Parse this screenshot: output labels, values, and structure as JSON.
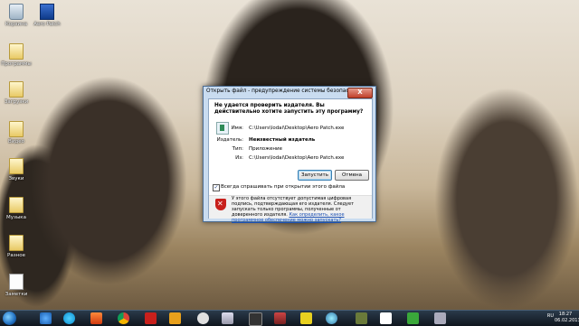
{
  "desktop": {
    "icons": [
      {
        "label": "Корзина",
        "icon": "recycle-bin-icon"
      },
      {
        "label": "Aero Patch",
        "icon": "aero-patch-icon"
      },
      {
        "label": "Программы",
        "icon": "folder-icon"
      },
      {
        "label": "Загрузки",
        "icon": "folder-icon"
      },
      {
        "label": "Видео",
        "icon": "folder-icon"
      },
      {
        "label": "Звуки",
        "icon": "folder-icon"
      },
      {
        "label": "Музыка",
        "icon": "folder-icon"
      },
      {
        "label": "Разное",
        "icon": "folder-icon"
      },
      {
        "label": "Заметки",
        "icon": "file-icon"
      }
    ]
  },
  "dialog": {
    "title": "Открыть файл - предупреждение системы безопасности",
    "close_label": "X",
    "question": "Не удается проверить издателя.  Вы действительно хотите запустить эту программу?",
    "fields": [
      {
        "label": "Имя:",
        "value": "C:\\Users\\lodai\\Desktop\\Aero Patch.exe"
      },
      {
        "label": "Издатель:",
        "value": "Неизвестный издатель"
      },
      {
        "label": "Тип:",
        "value": "Приложение"
      },
      {
        "label": "Из:",
        "value": "C:\\Users\\lodai\\Desktop\\Aero Patch.exe"
      }
    ],
    "run_label": "Запустить",
    "cancel_label": "Отмена",
    "checkbox_label": "Всегда спрашивать при открытии этого файла",
    "checkbox_checked": true,
    "warning_text": "У этого файла отсутствует допустимая цифровая подпись, подтверждающая его издателя. Следует запускать только программы, полученные от доверенного издателя.",
    "warning_link": "Как определить, какое программное обеспечение можно запускать?"
  },
  "taskbar": {
    "apps": [
      "ie-icon",
      "skype-icon",
      "chrome-icon",
      "kaspersky-icon",
      "h-icon",
      "panda-icon",
      "mail-icon",
      "media-icon",
      "video-icon",
      "pdf-icon",
      "maze-icon",
      "chat-icon",
      "game-icon",
      "utorrent-icon",
      "tool-icon"
    ],
    "language": "RU",
    "time": "18:27",
    "date": "06.02.2013"
  }
}
